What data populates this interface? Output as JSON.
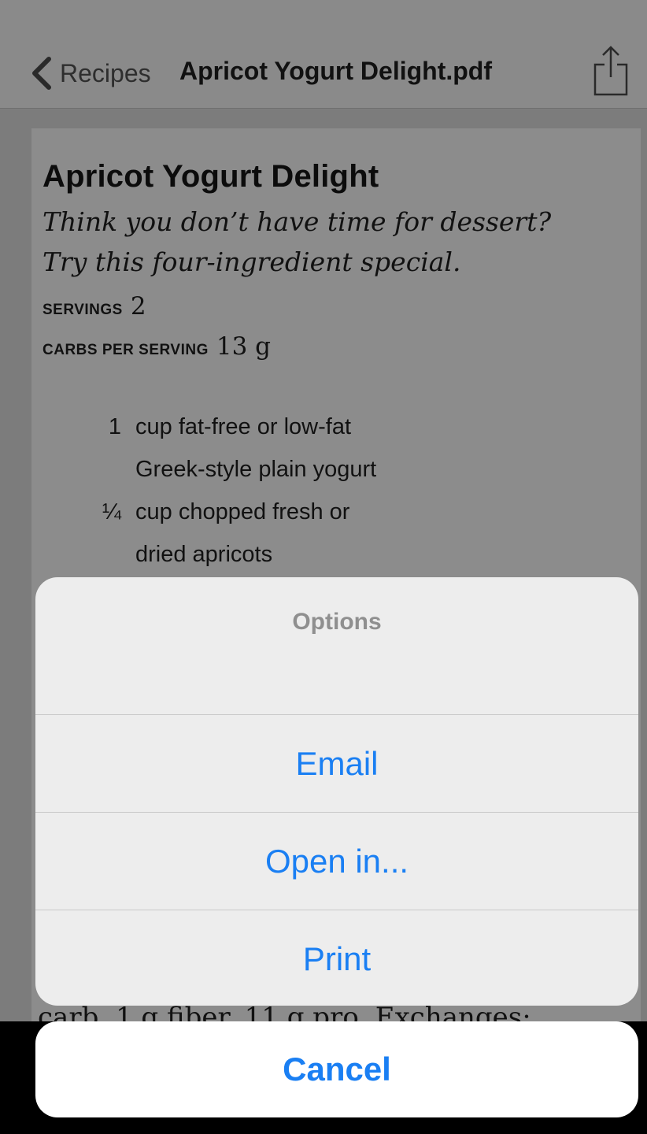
{
  "navbar": {
    "back_label": "Recipes",
    "title": "Apricot Yogurt Delight.pdf",
    "back_icon": "chevron-left-icon",
    "share_icon": "share-icon"
  },
  "document": {
    "title": "Apricot Yogurt Delight",
    "subtitle_line1": "Think you don’t have time for dessert?",
    "subtitle_line2": "Try this four-ingredient special.",
    "servings_label": "SERVINGS",
    "servings_value": "2",
    "carbs_label": "CARBS PER SERVING",
    "carbs_value": "13 g",
    "ingredients": [
      {
        "qty": "1",
        "line1": "cup fat-free or low-fat",
        "line2": "Greek-style plain yogurt"
      },
      {
        "qty": "¼",
        "line1": "cup chopped fresh or",
        "line2": "dried apricots"
      }
    ],
    "peek_text": "carb, 1 g fiber, 11 g pro. Exchanges:"
  },
  "action_sheet": {
    "title": "Options",
    "options": [
      "Email",
      "Open in...",
      "Print"
    ],
    "cancel_label": "Cancel"
  },
  "colors": {
    "accent": "#1a7ff3",
    "sheet_bg": "#ededed",
    "dimmed_bg": "#7e7e7e"
  }
}
